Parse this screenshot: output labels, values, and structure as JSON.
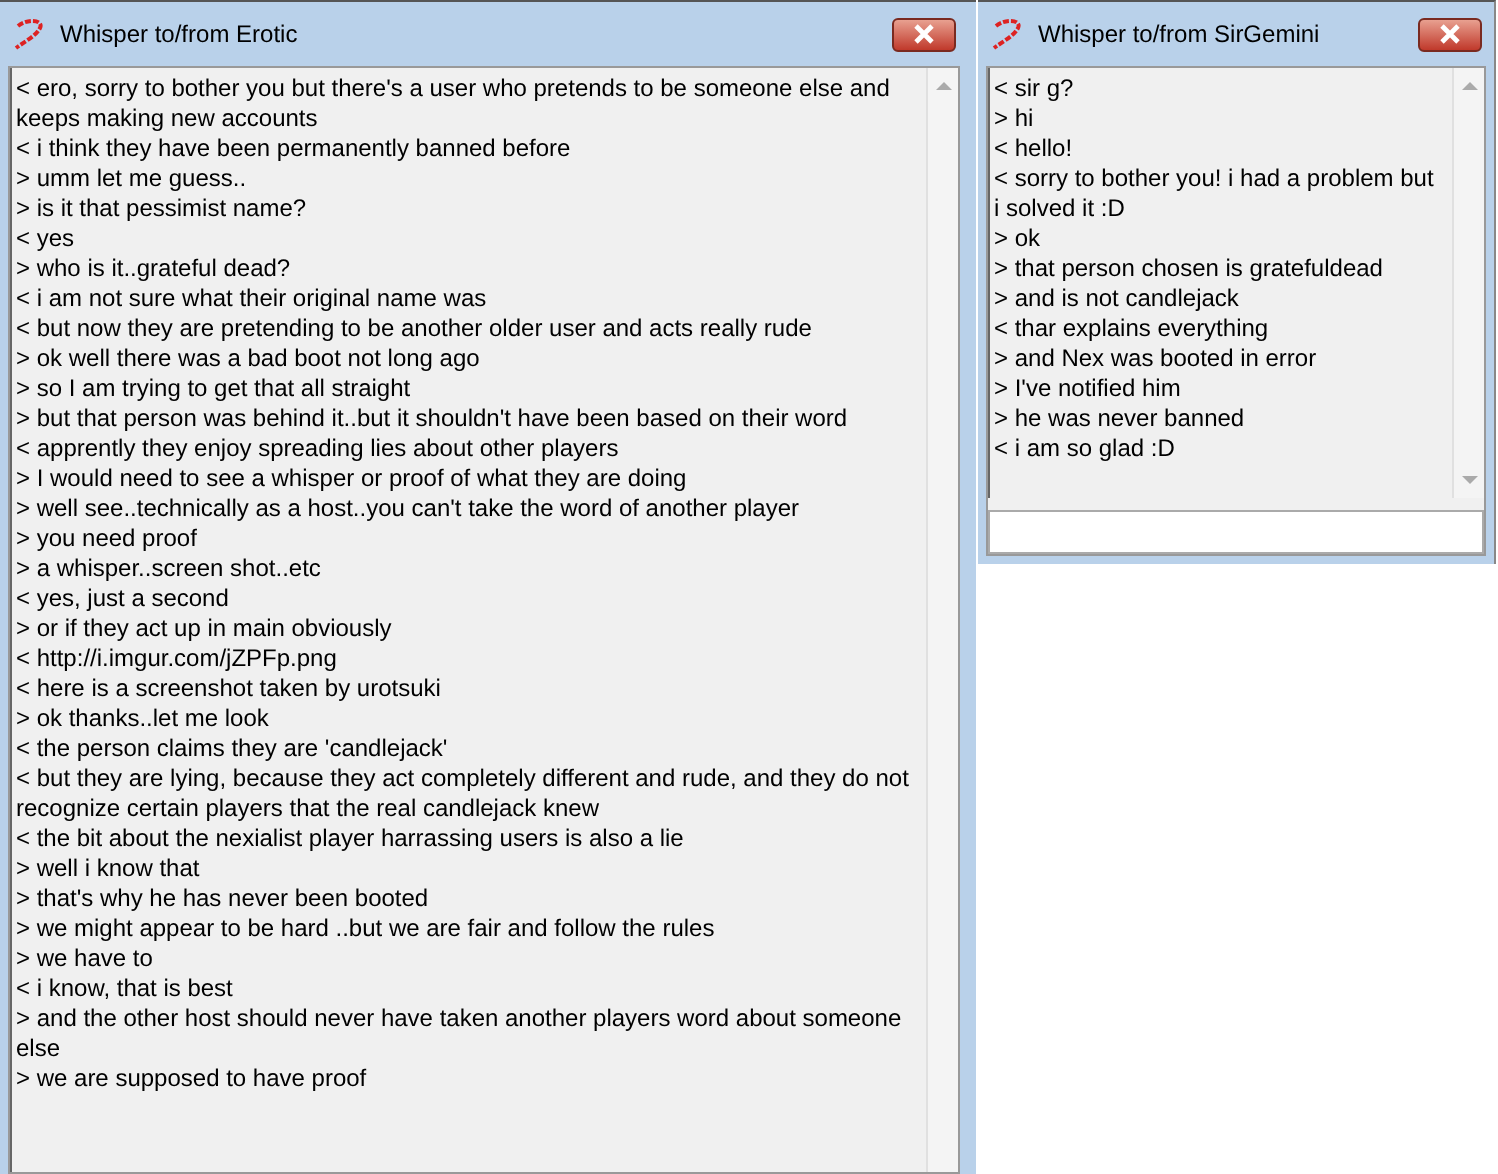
{
  "windows": [
    {
      "title": "Whisper to/from Erotic",
      "has_input": false,
      "messages": [
        "< ero, sorry to bother you but there's a user who pretends to be someone else and keeps making new accounts",
        "< i think they have been permanently banned before",
        "> umm let me guess..",
        "> is it that pessimist name?",
        "< yes",
        "> who is it..grateful dead?",
        "< i am not sure what their original name was",
        "< but now they are pretending to be another older user and acts really rude",
        "> ok well there was a bad boot not long ago",
        "> so I am trying to get that all straight",
        "> but that person was behind it..but it shouldn't have been based on their word",
        "< apprently they enjoy spreading lies about other players",
        "> I would need to see a whisper or proof of what they are doing",
        "> well see..technically as a host..you can't take the word of another player",
        "> you need proof",
        "> a whisper..screen shot..etc",
        "< yes, just a second",
        "> or if they act up in main obviously",
        "< http://i.imgur.com/jZPFp.png",
        "< here is a screenshot taken by urotsuki",
        "> ok thanks..let me look",
        "< the person claims they are 'candlejack'",
        "< but they are lying, because they act completely different and rude, and they do not recognize certain players that the real candlejack knew",
        "< the bit about the nexialist player harrassing users is also a lie",
        "> well i know that",
        "> that's why he has never been booted",
        "> we might appear to be hard ..but we are fair and follow the rules",
        "> we have to",
        "< i know, that is best",
        "> and the other host should never have taken another players word about someone else",
        "> we are supposed to have proof"
      ]
    },
    {
      "title": "Whisper to/from SirGemini",
      "has_input": true,
      "messages": [
        "< sir g?",
        "> hi",
        "< hello!",
        "< sorry to bother you! i had a problem but i solved it :D",
        "> ok",
        "> that person chosen is gratefuldead",
        "> and is not candlejack",
        "< thar explains everything",
        "> and Nex was booted in error",
        "> I've notified him",
        "> he was never banned",
        "< i am so glad :D"
      ]
    }
  ]
}
